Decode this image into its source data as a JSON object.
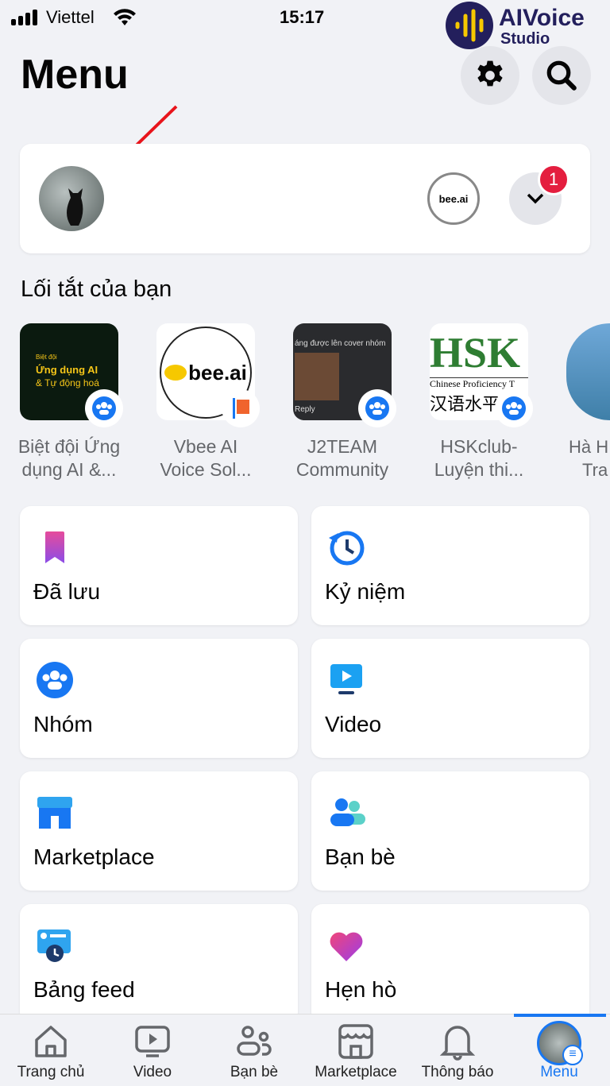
{
  "status": {
    "carrier": "Viettel",
    "time": "15:17"
  },
  "watermark": {
    "line1": "AIVoice",
    "line2": "Studio"
  },
  "header": {
    "title": "Menu"
  },
  "profile": {
    "notification_count": "1",
    "page_logo": "bee.ai"
  },
  "shortcuts": {
    "title": "Lối tắt của bạn",
    "items": [
      {
        "label1": "Biệt đội Ứng",
        "label2": "dụng AI &...",
        "thumb_small": "Biệt đội",
        "thumb_big": "Ứng dụng AI",
        "thumb_sub": "& Tự động hoá",
        "badge": "group-icon"
      },
      {
        "label1": "Vbee AI",
        "label2": "Voice Sol...",
        "thumb_big": "bee.ai",
        "badge": "flag-icon"
      },
      {
        "label1": "J2TEAM",
        "label2": "Community",
        "thumb_small": "áng được lên cover nhóm",
        "thumb_sub": "Reply",
        "badge": "group-icon"
      },
      {
        "label1": "HSKclub-",
        "label2": "Luyện thi...",
        "thumb_big": "HSK",
        "thumb_small": "Chinese Proficiency T",
        "thumb_sub": "汉语水平",
        "badge": "group-icon"
      },
      {
        "label1": "Hà H",
        "label2": "Tra"
      }
    ]
  },
  "menu_items": [
    {
      "label": "Đã lưu",
      "icon": "bookmark-icon"
    },
    {
      "label": "Kỷ niệm",
      "icon": "memories-clock-icon"
    },
    {
      "label": "Nhóm",
      "icon": "groups-icon"
    },
    {
      "label": "Video",
      "icon": "video-icon"
    },
    {
      "label": "Marketplace",
      "icon": "marketplace-icon"
    },
    {
      "label": "Bạn bè",
      "icon": "friends-icon"
    },
    {
      "label": "Bảng feed",
      "icon": "feeds-icon"
    },
    {
      "label": "Hẹn hò",
      "icon": "dating-heart-icon"
    }
  ],
  "nav": [
    {
      "label": "Trang chủ"
    },
    {
      "label": "Video"
    },
    {
      "label": "Bạn bè"
    },
    {
      "label": "Marketplace"
    },
    {
      "label": "Thông báo"
    },
    {
      "label": "Menu",
      "active": true
    }
  ],
  "colors": {
    "accent": "#1877f2",
    "badge": "#e41e3f",
    "bg": "#f1f2f6"
  }
}
